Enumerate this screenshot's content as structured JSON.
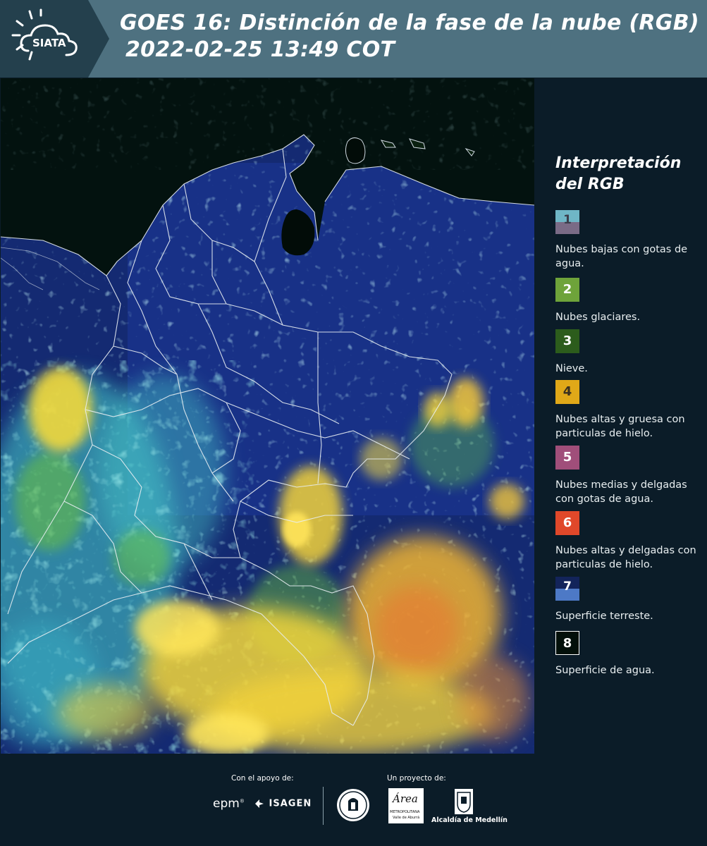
{
  "header": {
    "logo_text": "SIATA",
    "title_line1": "GOES 16: Distinción de la fase de la nube (RGB)",
    "title_line2": "2022-02-25 13:49 COT",
    "background_color": "#4e7180"
  },
  "legend": {
    "title_line1": "Interpretación",
    "title_line2": "del RGB",
    "items": [
      {
        "number": "1",
        "label": "Nubes bajas con gotas de agua.",
        "colors": [
          "#6fb6c6",
          "#7a6b86"
        ]
      },
      {
        "number": "2",
        "label": "Nubes glaciares.",
        "colors": [
          "#6ea33a"
        ]
      },
      {
        "number": "3",
        "label": "Nieve.",
        "colors": [
          "#2c5c1c"
        ]
      },
      {
        "number": "4",
        "label": "Nubes altas y gruesa con particulas de hielo.",
        "colors": [
          "#e0a818"
        ]
      },
      {
        "number": "5",
        "label": "Nubes medias y delgadas con gotas de agua.",
        "colors": [
          "#a04e7a"
        ]
      },
      {
        "number": "6",
        "label": "Nubes altas y delgadas con particulas de hielo.",
        "colors": [
          "#e0482a"
        ]
      },
      {
        "number": "7",
        "label": "Superficie terreste.",
        "colors": [
          "#13245a",
          "#4d79c6"
        ]
      },
      {
        "number": "8",
        "label": "Superficie de agua.",
        "colors": [
          "#03100a"
        ]
      }
    ]
  },
  "footer": {
    "support_label": "Con el apoyo de:",
    "project_label": "Un proyecto de:",
    "sponsor_epm": "epm",
    "sponsor_isagen": "ISAGEN",
    "area_logo_text": "Área",
    "area_subtext1": "METROPOLITANA",
    "area_subtext2": "Valle de Aburrá",
    "alcaldia": "Alcaldía de Medellín"
  },
  "map": {
    "type": "satellite-rgb-composite",
    "region": "Colombia"
  }
}
